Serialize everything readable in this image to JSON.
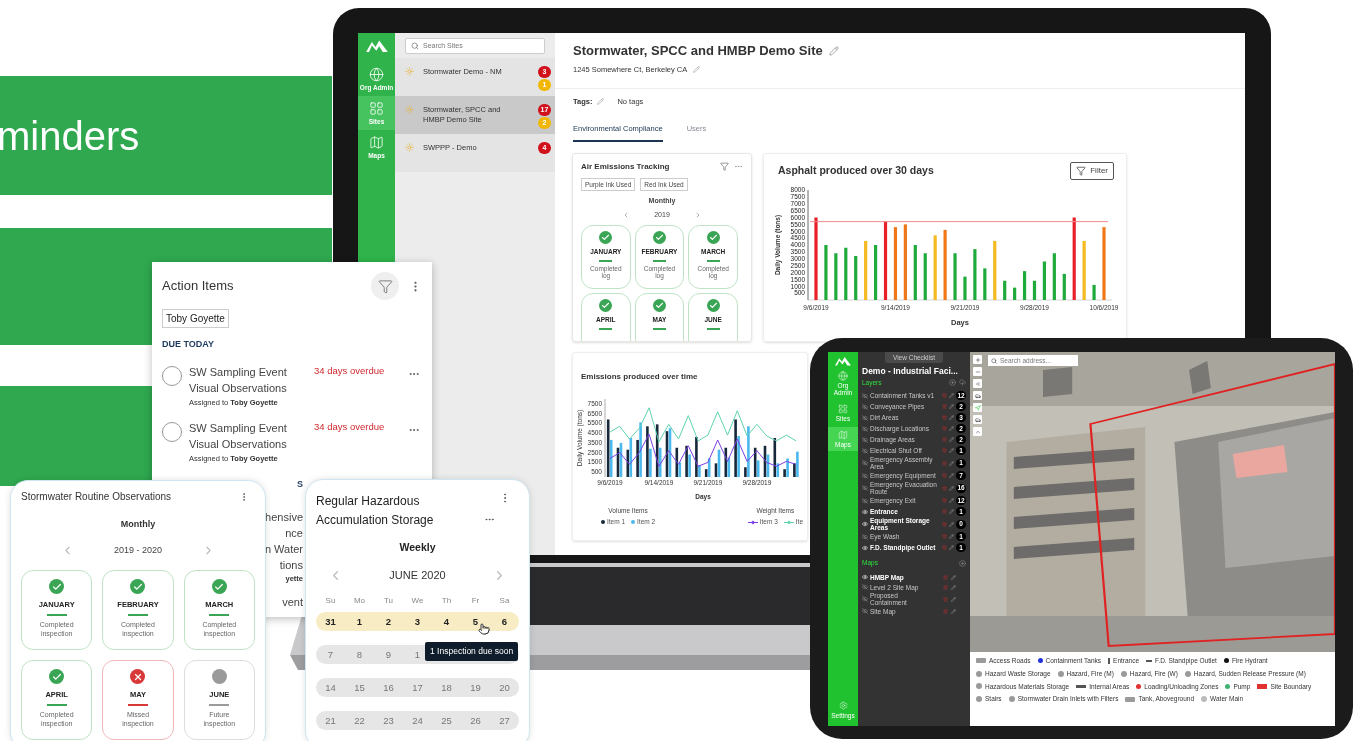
{
  "banner": {
    "text": "minders"
  },
  "laptop": {
    "nav": [
      {
        "label": "Org Admin",
        "selected": false
      },
      {
        "label": "Sites",
        "selected": true
      },
      {
        "label": "Maps",
        "selected": false
      }
    ],
    "search": {
      "placeholder": "Search Sites"
    },
    "sites": [
      {
        "name": "Stormwater Demo - NM",
        "selected": false,
        "badges": [
          {
            "count": "3",
            "color": "#d0111b"
          },
          {
            "count": "1",
            "color": "#f2b705"
          }
        ]
      },
      {
        "name": "Stormwater, SPCC and HMBP Demo Site",
        "selected": true,
        "badges": [
          {
            "count": "17",
            "color": "#d0111b"
          },
          {
            "count": "2",
            "color": "#f2b705"
          }
        ]
      },
      {
        "name": "SWPPP - Demo",
        "selected": false,
        "badges": [
          {
            "count": "4",
            "color": "#d0111b"
          }
        ]
      }
    ],
    "title": "Stormwater, SPCC and HMBP Demo Site",
    "address": "1245 Somewhere Ct, Berkeley CA",
    "tags_label": "Tags:",
    "tags_value": "No tags",
    "tabs": [
      {
        "label": "Environmental Compliance",
        "selected": true
      },
      {
        "label": "Users",
        "selected": false
      }
    ],
    "air_card": {
      "title": "Air Emissions Tracking",
      "chips": [
        "Purple Ink Used",
        "Red Ink Used"
      ],
      "period": "Monthly",
      "year": "2019",
      "months": [
        {
          "name": "JANUARY",
          "note": "Completed log",
          "kind": "completed"
        },
        {
          "name": "FEBRUARY",
          "note": "Completed log",
          "kind": "completed"
        },
        {
          "name": "MARCH",
          "note": "Completed log",
          "kind": "completed"
        },
        {
          "name": "APRIL",
          "kind": "completed"
        },
        {
          "name": "MAY",
          "kind": "completed"
        },
        {
          "name": "JUNE",
          "kind": "completed"
        }
      ]
    },
    "asphalt_card": {
      "filter": "Filter",
      "chart_data": {
        "type": "bar",
        "title": "Asphalt produced over 30 days",
        "xlabel": "Days",
        "ylabel": "Daily Volume (tons)",
        "categories": [
          "9/6/2019",
          null,
          null,
          null,
          null,
          null,
          null,
          null,
          "9/14/2019",
          null,
          null,
          null,
          null,
          null,
          null,
          "9/21/2019",
          null,
          null,
          null,
          null,
          null,
          null,
          "9/28/2019",
          null,
          null,
          null,
          null,
          null,
          null,
          "10/6/2019"
        ],
        "series": [
          {
            "color": "#1faa3c",
            "values": [
              null,
              4000,
              3400,
              3800,
              3200,
              null,
              4000,
              null,
              null,
              null,
              4000,
              3400,
              null,
              null,
              3400,
              1700,
              3700,
              2300,
              null,
              1400,
              900,
              2100,
              1400,
              2800,
              3400,
              1900,
              null,
              null,
              1100,
              null
            ]
          },
          {
            "color": "#f5b921",
            "values": [
              null,
              null,
              null,
              null,
              null,
              4300,
              null,
              null,
              null,
              null,
              null,
              null,
              4700,
              null,
              null,
              null,
              null,
              null,
              4300,
              null,
              null,
              null,
              null,
              null,
              null,
              null,
              null,
              4300,
              null,
              null
            ]
          },
          {
            "color": "#f07818",
            "values": [
              null,
              null,
              null,
              null,
              null,
              null,
              null,
              null,
              5300,
              5500,
              null,
              null,
              null,
              5100,
              null,
              null,
              null,
              null,
              null,
              null,
              null,
              null,
              null,
              null,
              null,
              null,
              null,
              null,
              null,
              5300
            ]
          },
          {
            "color": "#e8202a",
            "values": [
              6000,
              null,
              null,
              null,
              null,
              null,
              null,
              5700,
              null,
              null,
              null,
              null,
              null,
              null,
              null,
              null,
              null,
              null,
              null,
              null,
              null,
              null,
              null,
              null,
              null,
              null,
              6000,
              null,
              null,
              null
            ]
          }
        ],
        "ylim": [
          0,
          8000
        ],
        "yticks": [
          500,
          1000,
          1500,
          2000,
          2500,
          3000,
          3500,
          4000,
          4500,
          5000,
          5500,
          6000,
          6500,
          7000,
          7500,
          8000
        ],
        "ref_lines": [
          {
            "axis": "y",
            "value": 5700
          }
        ]
      }
    },
    "emissions_card": {
      "title": "Emissions produced over time",
      "chart_data": {
        "type": "bar",
        "xlabel": "Days",
        "ylabel": "Daily Volume (tons)",
        "categories": [
          "9/6/2019",
          null,
          null,
          null,
          null,
          "9/14/2019",
          null,
          null,
          null,
          null,
          "9/21/2019",
          null,
          null,
          null,
          null,
          "9/28/2019",
          null,
          null,
          null,
          null
        ],
        "series": [
          {
            "name": "Item 1",
            "type": "bar",
            "color": "#17283a",
            "values": [
              5900,
              3000,
              2800,
              3800,
              5200,
              5400,
              4700,
              3000,
              3200,
              4100,
              800,
              1400,
              3000,
              5900,
              1000,
              3000,
              3200,
              4000,
              800,
              1400
            ]
          },
          {
            "name": "Item 2",
            "type": "bar",
            "color": "#4bb8ee",
            "values": [
              3800,
              3500,
              4000,
              5600,
              2900,
              3000,
              5000,
              1500,
              2300,
              1200,
              1900,
              2800,
              2000,
              4200,
              5200,
              1700,
              2300,
              1400,
              1900,
              2600
            ]
          },
          {
            "name": "Item 3",
            "type": "line",
            "color": "#7b3fe4",
            "values": [
              1900,
              2500,
              1300,
              2500,
              4400,
              1100,
              2700,
              1300,
              3200,
              1100,
              1500,
              3800,
              1600,
              3900,
              1600,
              2700,
              1500,
              1100,
              1600,
              1300
            ]
          },
          {
            "name": "Ite",
            "type": "line",
            "color": "#5fd3b0",
            "values": [
              4600,
              5200,
              3900,
              5000,
              7100,
              3600,
              5400,
              3900,
              6300,
              3700,
              4300,
              6700,
              4300,
              6800,
              4200,
              5400,
              4200,
              3700,
              4300,
              3700
            ]
          }
        ],
        "ylim": [
          0,
          8000
        ],
        "yticks": [
          500,
          1500,
          2500,
          3500,
          4500,
          5500,
          6500,
          7500
        ]
      },
      "legend_groups": [
        {
          "title": "Volume Items"
        },
        {
          "title": "Weight Items"
        }
      ]
    }
  },
  "action_items": {
    "title": "Action Items",
    "filter_chip": "Toby Goyette",
    "section": "DUE TODAY",
    "items": [
      {
        "title": "SW Sampling Event Visual Observations",
        "status": "34 days overdue",
        "assigned": "Assigned to **Toby Goyette**",
        "done": false
      },
      {
        "title": "SW Sampling Event Visual Observations",
        "status": "34 days overdue",
        "assigned": "Assigned to **Toby Goyette**",
        "done": false
      }
    ],
    "covered": {
      "heading": "S",
      "lines": [
        "hensive",
        "nce",
        "n Water",
        "tions"
      ],
      "assignee": "yette",
      "next": "vent"
    }
  },
  "routine_card": {
    "title": "Stormwater Routine Observations",
    "period": "Monthly",
    "range": "2019 - 2020",
    "months": [
      {
        "name": "JANUARY",
        "note": "Completed inspection",
        "kind": "completed"
      },
      {
        "name": "FEBRUARY",
        "note": "Completed inspection",
        "kind": "completed"
      },
      {
        "name": "MARCH",
        "note": "Completed inspection",
        "kind": "completed"
      },
      {
        "name": "APRIL",
        "note": "Completed inspection",
        "kind": "completed"
      },
      {
        "name": "MAY",
        "note": "Missed inspection",
        "kind": "missed"
      },
      {
        "name": "JUNE",
        "note": "Future inspection",
        "kind": "future"
      }
    ]
  },
  "hazard_card": {
    "title": "Regular Hazardous Accumulation Storage",
    "period": "Weekly",
    "month": "JUNE 2020",
    "weekdays": [
      "Su",
      "Mo",
      "Tu",
      "We",
      "Th",
      "Fr",
      "Sa"
    ],
    "weeks": [
      {
        "days": [
          "31",
          "1",
          "2",
          "3",
          "4",
          "5",
          "6"
        ],
        "selected": true
      },
      {
        "days": [
          "7",
          "8",
          "9",
          "1"
        ],
        "selected": false
      },
      {
        "days": [
          "14",
          "15",
          "16",
          "17",
          "18",
          "19",
          "20"
        ],
        "selected": false
      },
      {
        "days": [
          "21",
          "22",
          "23",
          "24",
          "25",
          "26",
          "27"
        ],
        "selected": false
      }
    ],
    "tooltip": "1 Inspection due soon"
  },
  "tablet": {
    "top_button": "View Checklist",
    "title": "Demo - Industrial Faci...",
    "nav": [
      {
        "label": "Org Admin",
        "selected": false
      },
      {
        "label": "Sites",
        "selected": false
      },
      {
        "label": "Maps",
        "selected": true
      }
    ],
    "settings": "Settings",
    "layers_heading": "Layers",
    "layers": [
      {
        "name": "Containment Tanks v1",
        "count": "12",
        "visible": false
      },
      {
        "name": "Conveyance Pipes",
        "count": "2",
        "visible": false
      },
      {
        "name": "Dirt Areas",
        "count": "3",
        "visible": false
      },
      {
        "name": "Discharge Locations",
        "count": "2",
        "visible": false
      },
      {
        "name": "Drainage Areas",
        "count": "2",
        "visible": false
      },
      {
        "name": "Electrical Shut Off",
        "count": "1",
        "visible": false
      },
      {
        "name": "Emergency Assembly Area",
        "count": "1",
        "visible": false
      },
      {
        "name": "Emergency Equipment",
        "count": "7",
        "visible": false
      },
      {
        "name": "Emergency Evacuation Route",
        "count": "16",
        "visible": false
      },
      {
        "name": "Emergency Exit",
        "count": "12",
        "visible": false
      },
      {
        "name": "Entrance",
        "count": "1",
        "visible": true
      },
      {
        "name": "Equipment Storage Areas",
        "count": "0",
        "visible": true
      },
      {
        "name": "Eye Wash",
        "count": "1",
        "visible": false
      },
      {
        "name": "F.D. Standpipe Outlet",
        "count": "1",
        "visible": true
      }
    ],
    "maps_heading": "Maps",
    "maps": [
      {
        "name": "HMBP Map",
        "visible": true
      },
      {
        "name": "Level 2 Site Map",
        "visible": false
      },
      {
        "name": "Proposed Containment",
        "visible": false
      },
      {
        "name": "Site Map",
        "visible": false
      }
    ],
    "map_search": {
      "placeholder": "Search address..."
    },
    "legend": [
      {
        "label": "Access Roads",
        "kind": "road",
        "color": "#9a9a9a"
      },
      {
        "label": "Containment Tanks",
        "kind": "dot",
        "color": "#2233dd"
      },
      {
        "label": "Entrance",
        "kind": "bracket",
        "color": "#555555"
      },
      {
        "label": "F.D. Standpipe Outlet",
        "kind": "pipe",
        "color": "#555555"
      },
      {
        "label": "Fire Hydrant",
        "kind": "dot",
        "color": "#111111"
      },
      {
        "label": "Hazard Waste Storage",
        "kind": "ring",
        "color": "#9a9a9a"
      },
      {
        "label": "Hazard, Fire (M)",
        "kind": "ring",
        "color": "#9a9a9a"
      },
      {
        "label": "Hazard, Fire (W)",
        "kind": "ring",
        "color": "#9a9a9a"
      },
      {
        "label": "Hazard, Sudden Release Pressure (M)",
        "kind": "ring",
        "color": "#9a9a9a"
      },
      {
        "label": "Hazardous Materials Storage",
        "kind": "ring",
        "color": "#9a9a9a"
      },
      {
        "label": "Internal Areas",
        "kind": "dashed",
        "color": "#555555"
      },
      {
        "label": "Loading/Unloading Zones",
        "kind": "dot",
        "color": "#e03030"
      },
      {
        "label": "Pump",
        "kind": "dot",
        "color": "#3cb371"
      },
      {
        "label": "Site Boundary",
        "kind": "boundary",
        "color": "#e03030"
      },
      {
        "label": "Stairs",
        "kind": "ring",
        "color": "#9a9a9a"
      },
      {
        "label": "Stormwater Drain Inlets with Filters",
        "kind": "ring",
        "color": "#9a9a9a"
      },
      {
        "label": "Tank, Aboveground",
        "kind": "road",
        "color": "#9a9a9a"
      },
      {
        "label": "Water Main",
        "kind": "ring",
        "color": "#bbbbbb"
      }
    ]
  }
}
